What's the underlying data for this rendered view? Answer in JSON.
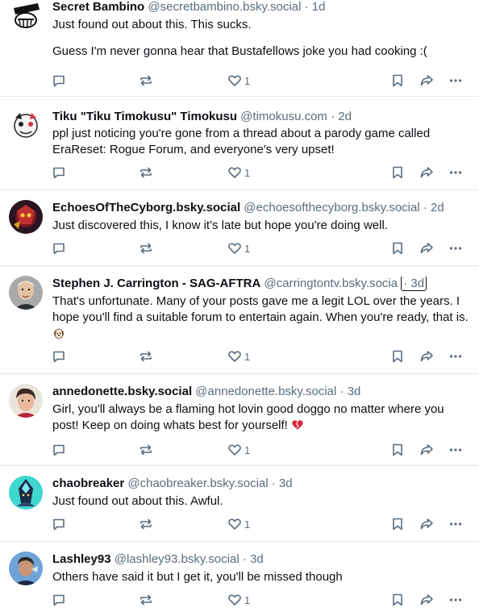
{
  "posts": [
    {
      "name": "Secret Bambino",
      "handle": "@secretbambino.bsky.social",
      "time": "1d",
      "text1": "Just found out about this. This sucks.",
      "text2": "Guess I'm never gonna hear that Bustafellows joke you had cooking :(",
      "likes": "1"
    },
    {
      "name": "Tiku \"Tiku Timokusu\" Timokusu",
      "handle": "@timokusu.com",
      "time": "2d",
      "text": "ppl just noticing you're gone from a thread about a parody game called EraReset: Rogue Forum, and everyone's very upset!",
      "likes": "1"
    },
    {
      "name": "EchoesOfTheCyborg.bsky.social",
      "handle": "@echoesofthecyborg.bsky.social",
      "time": "2d",
      "text": "Just discovered this, I know it's late but hope you're doing well.",
      "likes": "1"
    },
    {
      "name": "Stephen J. Carrington - SAG-AFTRA",
      "handle": "@carringtontv.bsky.socia",
      "time": "· 3d",
      "text": "That's unfortunate. Many of your posts gave me a legit LOL over the years. I hope you'll find a suitable forum to entertain again. When you're ready, that is.",
      "likes": "1"
    },
    {
      "name": "annedonette.bsky.social",
      "handle": "@annedonette.bsky.social",
      "time": "3d",
      "text": "Girl, you'll always be a flaming hot lovin good doggo no matter where you post! Keep on doing whats best for yourself!",
      "likes": "1"
    },
    {
      "name": "chaobreaker",
      "handle": "@chaobreaker.bsky.social",
      "time": "3d",
      "text": "Just found out about this. Awful.",
      "likes": "1"
    },
    {
      "name": "Lashley93",
      "handle": "@lashley93.bsky.social",
      "time": "3d",
      "text": "Others have said it but I get it, you'll be missed though",
      "likes": "1"
    }
  ],
  "separator": "·",
  "icons": {
    "reply": "reply-icon",
    "repost": "repost-icon",
    "like": "heart-icon",
    "bookmark": "bookmark-icon",
    "share": "share-icon",
    "more": "more-icon"
  },
  "colors": {
    "name": "#0b0f14",
    "muted": "#5b6c7d",
    "border": "#e4e8ec"
  }
}
